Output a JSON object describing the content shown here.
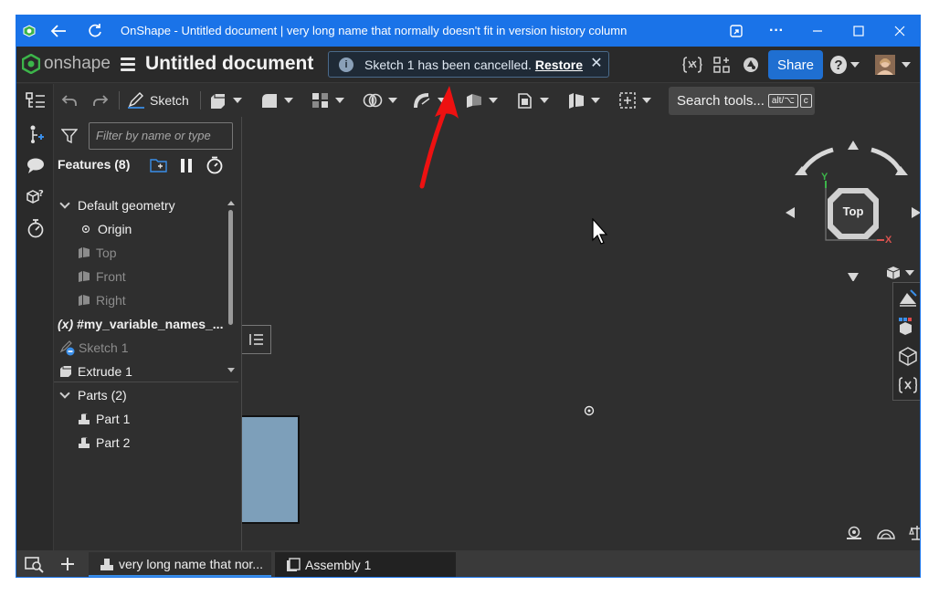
{
  "window": {
    "title": "OnShape - Untitled document | very long name that normally doesn't fit in version history column",
    "accent_color": "#1a73e8"
  },
  "header": {
    "logo_text": "onshape",
    "document_title": "Untitled document",
    "toast": {
      "info_icon": "i",
      "message": "Sketch 1 has been cancelled.",
      "action_label": "Restore",
      "close_label": "✕"
    },
    "share_label": "Share",
    "help_label": "?"
  },
  "toolbar": {
    "sketch_label": "Sketch",
    "search_label": "Search tools...",
    "search_shortcut_1": "alt/⌥",
    "search_shortcut_2": "c"
  },
  "feature_panel": {
    "filter_placeholder": "Filter by name or type",
    "features_header": "Features (8)",
    "default_geometry": "Default geometry",
    "origin": "Origin",
    "top": "Top",
    "front": "Front",
    "right": "Right",
    "variable": "#my_variable_names_...",
    "variable_icon": "(x)",
    "sketch1": "Sketch 1",
    "extrude1": "Extrude 1",
    "parts_header": "Parts (2)",
    "part1": "Part 1",
    "part2": "Part 2"
  },
  "viewcube": {
    "face_label": "Top",
    "axis_y": "Y",
    "axis_x": "X"
  },
  "tabs": {
    "tab1": "very long name that nor...",
    "tab2": "Assembly 1"
  },
  "colors": {
    "part_fill": "#7d9fba",
    "toast_bg": "#1f2a36",
    "share_bg": "#1f6fd1",
    "annotation_arrow": "#ee1111"
  }
}
